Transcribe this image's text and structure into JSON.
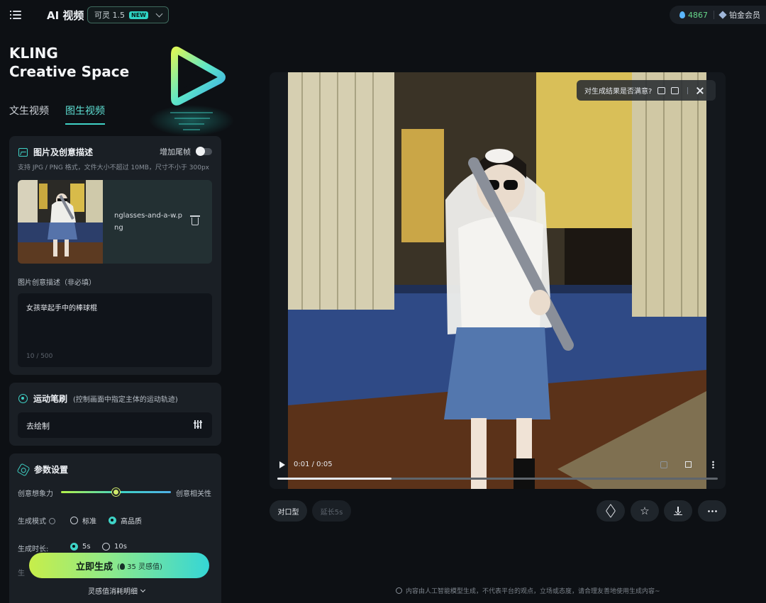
{
  "topbar": {
    "app_title": "AI 视频",
    "model": {
      "label": "可灵 1.5",
      "badge": "NEW"
    },
    "credits": "4867",
    "membership": "铂金会员"
  },
  "brand": {
    "line1": "KLING",
    "line2": "Creative Space"
  },
  "tabs": [
    {
      "label": "文生视频",
      "active": false
    },
    {
      "label": "图生视频",
      "active": true
    }
  ],
  "image_card": {
    "title": "图片及创意描述",
    "toggle_label": "增加尾帧",
    "toggle_on": false,
    "hint": "支持 JPG / PNG 格式，文件大小不超过 10MB，尺寸不小于 300px",
    "filename": "nglasses-and-a-w.png",
    "desc_label": "图片创意描述（非必填）",
    "desc_text": "女孩举起手中的棒球棍",
    "desc_count": "10 / 500"
  },
  "brush_card": {
    "title": "运动笔刷",
    "subtitle": "(控制画面中指定主体的运动轨迹)",
    "draw_label": "去绘制"
  },
  "params_card": {
    "title": "参数设置",
    "slider_left": "创意想象力",
    "slider_right": "创意相关性",
    "slider_value": 0.5,
    "mode_label": "生成模式",
    "mode_options": [
      "标准",
      "高品质"
    ],
    "mode_selected": "高品质",
    "duration_label": "生成时长:",
    "duration_options": [
      "5s",
      "10s"
    ],
    "duration_selected": "5s",
    "next_row_label": "生"
  },
  "generate": {
    "label": "立即生成",
    "cost": "35 灵感值",
    "cost_detail": "灵感值消耗明细"
  },
  "feedback": {
    "question": "对生成结果是否满意?"
  },
  "player": {
    "time": "0:01 / 0:05",
    "progress": 0.26
  },
  "actions": {
    "lip_sync": "对口型",
    "extend": "延长5s"
  },
  "disclaimer": "内容由人工智能模型生成，不代表平台的观点，立场或态度，请合理友善地使用生成内容~",
  "colors": {
    "accent": "#3fd2c6",
    "credits": "#66d68a",
    "generate_from": "#c7ee4a",
    "generate_to": "#35d6d6"
  }
}
